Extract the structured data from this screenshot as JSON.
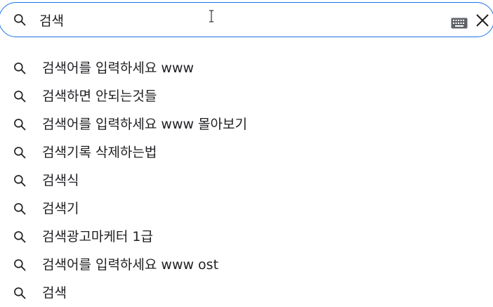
{
  "search": {
    "query": "검색",
    "icons": {
      "lead": "search-icon",
      "cursor": "text-cursor-icon",
      "keyboard": "keyboard-icon",
      "clear": "close-icon"
    },
    "accent_color": "#1a73e8"
  },
  "suggestions": [
    {
      "text": "검색어를 입력하세요 www",
      "icon": "search-icon"
    },
    {
      "text": "검색하면 안되는것들",
      "icon": "search-icon"
    },
    {
      "text": "검색어를 입력하세요 www 몰아보기",
      "icon": "search-icon"
    },
    {
      "text": "검색기록 삭제하는법",
      "icon": "search-icon"
    },
    {
      "text": "검색식",
      "icon": "search-icon"
    },
    {
      "text": "검색기",
      "icon": "search-icon"
    },
    {
      "text": "검색광고마케터 1급",
      "icon": "search-icon"
    },
    {
      "text": "검색어를 입력하세요 www ost",
      "icon": "search-icon"
    },
    {
      "text": "검색",
      "icon": "search-icon"
    }
  ]
}
